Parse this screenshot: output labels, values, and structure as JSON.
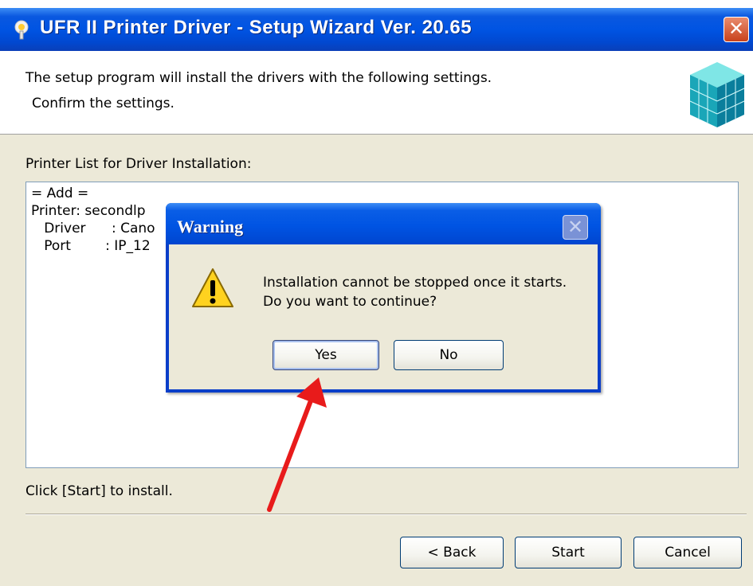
{
  "window": {
    "title": "UFR II Printer Driver - Setup Wizard Ver. 20.65",
    "close_glyph": "✕"
  },
  "header": {
    "line1": "The setup program will install the drivers with the following settings.",
    "line2": "Confirm the settings.",
    "icon": "cube-icon"
  },
  "printer_list": {
    "label": "Printer List for Driver Installation:",
    "lines": [
      "= Add =",
      "Printer: secondlp",
      "   Driver      : Cano",
      "   Port        : IP_12"
    ]
  },
  "status": {
    "text": "Click [Start] to install."
  },
  "buttons": {
    "back": "< Back",
    "start": "Start",
    "cancel": "Cancel"
  },
  "dialog": {
    "title": "Warning",
    "close_glyph": "✕",
    "message_line1": "Installation cannot be stopped once it starts.",
    "message_line2": "Do you want to continue?",
    "yes": "Yes",
    "no": "No",
    "icon": "warning-icon"
  },
  "annotation": {
    "arrow_color": "#e81b1b"
  },
  "colors": {
    "titlebar": "#0054e3",
    "face": "#ece9d8"
  }
}
